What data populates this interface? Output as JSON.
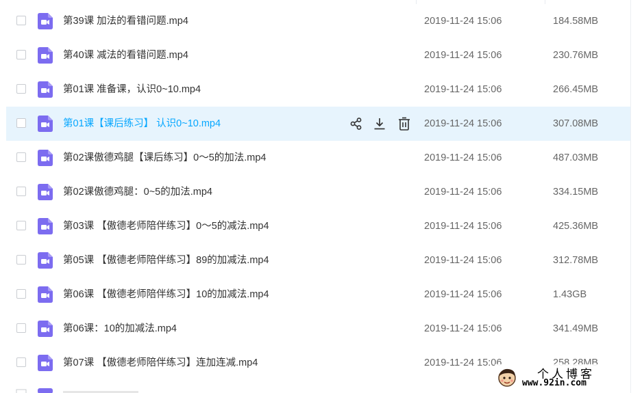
{
  "files": [
    {
      "name": "第39课  加法的看错问题.mp4",
      "modified": "2019-11-24 15:06",
      "size": "184.58MB"
    },
    {
      "name": "第40课  减法的看错问题.mp4",
      "modified": "2019-11-24 15:06",
      "size": "230.76MB"
    },
    {
      "name": "第01课 准备课，认识0~10.mp4",
      "modified": "2019-11-24 15:06",
      "size": "266.45MB"
    },
    {
      "name": "第01课【课后练习】 认识0~10.mp4",
      "modified": "2019-11-24 15:06",
      "size": "307.08MB",
      "hovered": true
    },
    {
      "name": "第02课傲德鸡腿【课后练习】0～5的加法.mp4",
      "modified": "2019-11-24 15:06",
      "size": "487.03MB"
    },
    {
      "name": "第02课傲德鸡腿：0~5的加法.mp4",
      "modified": "2019-11-24 15:06",
      "size": "334.15MB"
    },
    {
      "name": "第03课 【傲德老师陪伴练习】0～5的减法.mp4",
      "modified": "2019-11-24 15:06",
      "size": "425.36MB"
    },
    {
      "name": "第05课 【傲德老师陪伴练习】89的加减法.mp4",
      "modified": "2019-11-24 15:06",
      "size": "312.78MB"
    },
    {
      "name": "第06课 【傲德老师陪伴练习】10的加减法.mp4",
      "modified": "2019-11-24 15:06",
      "size": "1.43GB"
    },
    {
      "name": "第06课：10的加减法.mp4",
      "modified": "2019-11-24 15:06",
      "size": "341.49MB"
    },
    {
      "name": "第07课 【傲德老师陪伴练习】连加连减.mp4",
      "modified": "2019-11-24 15:06",
      "size": "258.28MB"
    }
  ],
  "hover_actions": [
    "share-icon",
    "download-icon",
    "delete-icon"
  ],
  "watermark": {
    "title": "个人博客",
    "url": "www.92in.com"
  },
  "colors": {
    "accent": "#06a7ff",
    "hover_row": "#e7f4fd",
    "video_icon": "#7c6cf0",
    "text": "#333333",
    "muted_text": "#666666"
  }
}
